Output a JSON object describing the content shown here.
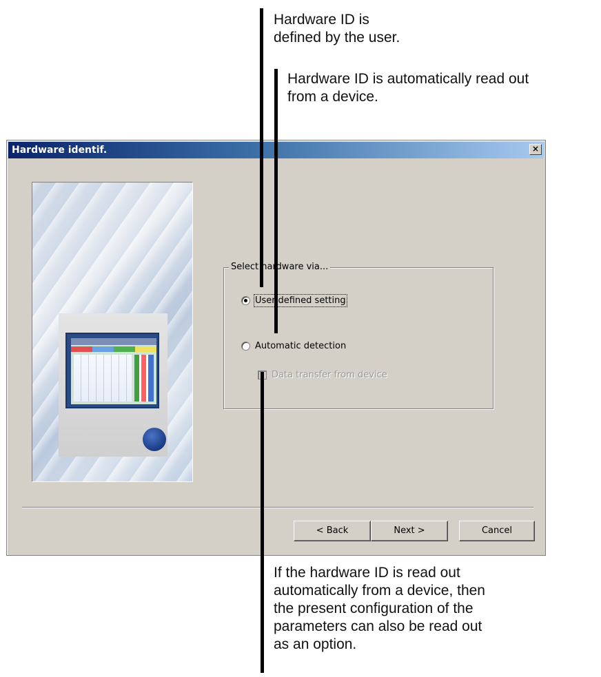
{
  "annotations": {
    "user_defined": [
      "Hardware ID is",
      "defined by the user."
    ],
    "automatic": [
      "Hardware ID is automatically read out",
      "from a device."
    ],
    "data_transfer": [
      "If the hardware ID is read out",
      "automatically from a device, then",
      "the present configuration of the",
      "parameters can also be read out",
      "as an option."
    ]
  },
  "dialog": {
    "title": "Hardware identif.",
    "close_symbol": "×",
    "group_title": "Select hardware via...",
    "options": {
      "user_defined": "User-defined setting",
      "automatic": "Automatic detection",
      "data_transfer": "Data transfer from device"
    },
    "selected_option": "user_defined",
    "data_transfer_enabled": false,
    "data_transfer_checked": false,
    "buttons": {
      "back": "< Back",
      "next": "Next >",
      "cancel": "Cancel"
    }
  },
  "colors": {
    "titlebar_start": "#0a246a",
    "titlebar_end": "#a6caf0",
    "dialog_face": "#d4d0c8"
  }
}
